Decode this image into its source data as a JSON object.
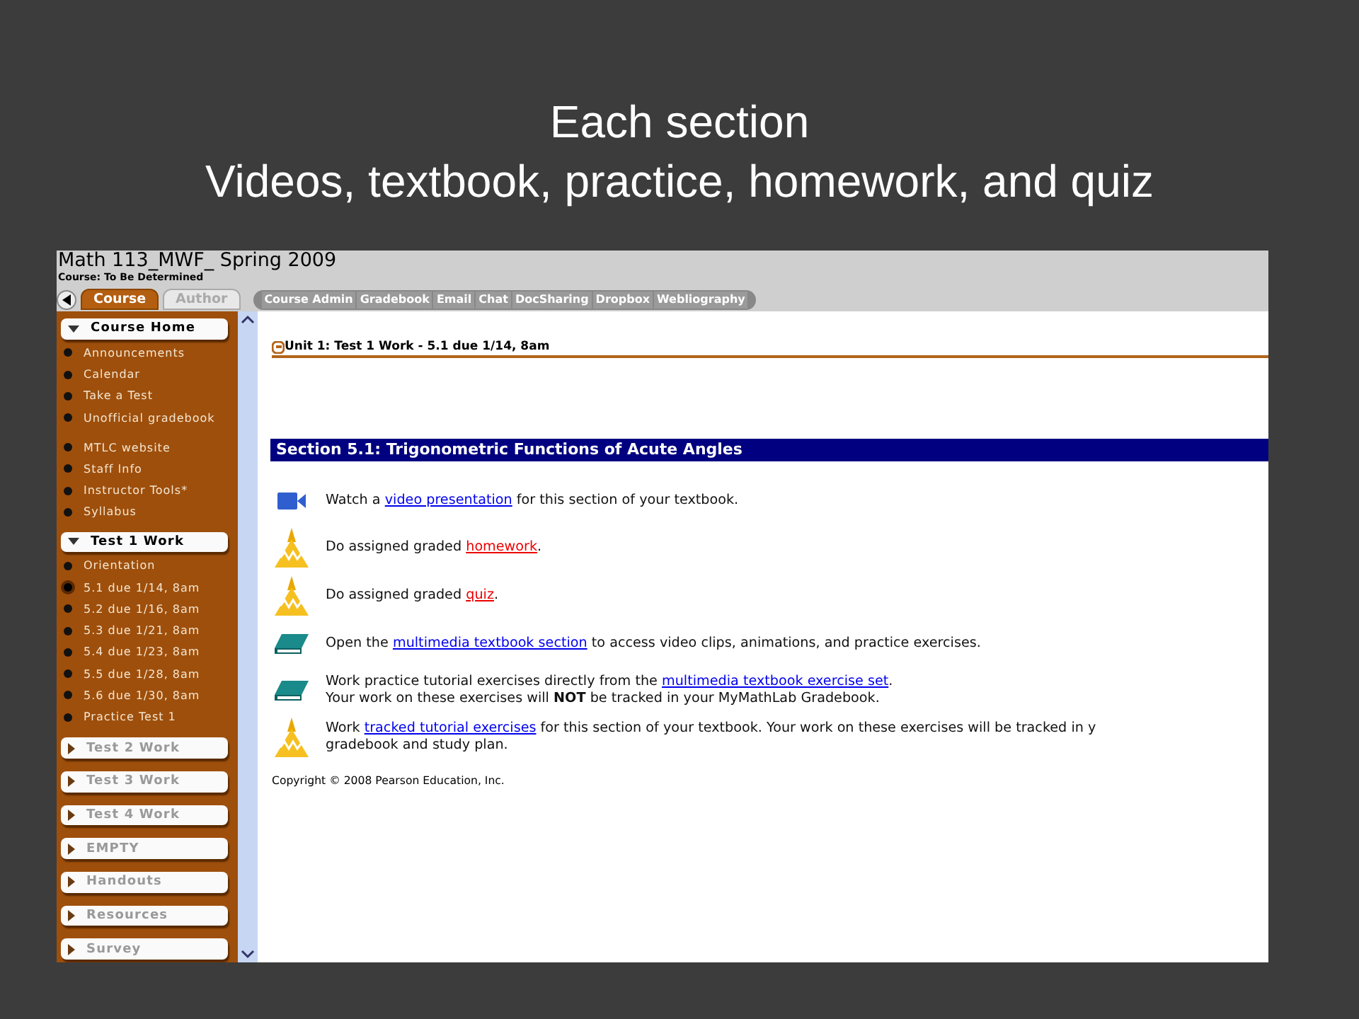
{
  "slide": {
    "title_lines": [
      "Each section",
      "Videos, textbook, practice, homework, and quiz"
    ]
  },
  "course_window": {
    "title": "Math 113_MWF_ Spring 2009",
    "subtitle": "Course: To Be Determined",
    "tabs": [
      {
        "label": "Course",
        "selected": true
      },
      {
        "label": "Author",
        "selected": false
      }
    ],
    "toolbar": [
      "Course Admin",
      "Gradebook",
      "Email",
      "Chat",
      "DocSharing",
      "Dropbox",
      "Webliography"
    ],
    "sidebar": {
      "groups": [
        {
          "label": "Course Home",
          "expanded": true,
          "items": [
            {
              "label": "Announcements",
              "selected": false,
              "separated": false
            },
            {
              "label": "Calendar",
              "selected": false,
              "separated": false
            },
            {
              "label": "Take a Test",
              "selected": false,
              "separated": false
            },
            {
              "label": "Unofficial gradebook",
              "selected": false,
              "separated": false
            },
            {
              "label": "MTLC website",
              "selected": false,
              "separated": true
            },
            {
              "label": "Staff Info",
              "selected": false,
              "separated": false
            },
            {
              "label": "Instructor Tools*",
              "selected": false,
              "separated": false
            },
            {
              "label": "Syllabus",
              "selected": false,
              "separated": false
            }
          ]
        },
        {
          "label": "Test 1 Work",
          "expanded": true,
          "items": [
            {
              "label": "Orientation",
              "selected": false,
              "separated": false
            },
            {
              "label": "5.1 due 1/14, 8am",
              "selected": true,
              "separated": false
            },
            {
              "label": "5.2 due 1/16, 8am",
              "selected": false,
              "separated": false
            },
            {
              "label": "5.3 due 1/21, 8am",
              "selected": false,
              "separated": false
            },
            {
              "label": "5.4 due 1/23, 8am",
              "selected": false,
              "separated": false
            },
            {
              "label": "5.5 due 1/28, 8am",
              "selected": false,
              "separated": false
            },
            {
              "label": "5.6 due 1/30, 8am",
              "selected": false,
              "separated": false
            },
            {
              "label": "Practice Test 1",
              "selected": false,
              "separated": false
            }
          ]
        },
        {
          "label": "Test 2 Work",
          "expanded": false
        },
        {
          "label": "Test 3 Work",
          "expanded": false
        },
        {
          "label": "Test 4 Work",
          "expanded": false
        },
        {
          "label": "EMPTY",
          "expanded": false
        },
        {
          "label": "Handouts",
          "expanded": false
        },
        {
          "label": "Resources",
          "expanded": false
        },
        {
          "label": "Survey",
          "expanded": false
        }
      ]
    },
    "content": {
      "unit_heading": "Unit  1:  Test 1 Work - 5.1 due 1/14, 8am",
      "section_heading": "Section 5.1: Trigonometric Functions of Acute Angles",
      "activities": [
        {
          "kind": "video",
          "before": "Watch a ",
          "link": "video presentation",
          "color": "#0000ee",
          "after": " for this section of your textbook."
        },
        {
          "kind": "graded",
          "before": "Do assigned graded ",
          "link": "homework",
          "color": "#ee0000",
          "after": "."
        },
        {
          "kind": "graded",
          "before": "Do assigned graded ",
          "link": "quiz",
          "color": "#ee0000",
          "after": "."
        },
        {
          "kind": "book",
          "before": "Open the ",
          "link": "multimedia textbook section",
          "color": "#0000ee",
          "after": " to access video clips, animations, and practice exercises."
        },
        {
          "kind": "book",
          "before": "Work practice tutorial exercises directly from the ",
          "link": "multimedia textbook exercise set",
          "color": "#0000ee",
          "after": ".",
          "note": "Your work on these exercises will **NOT** be tracked in your MyMathLab Gradebook."
        },
        {
          "kind": "graded",
          "before": "Work ",
          "link": "tracked tutorial exercises",
          "color": "#0000ee",
          "after": " for this section of your textbook. Your work on these exercises will be tracked in y",
          "note": "gradebook and study plan."
        }
      ],
      "copyright": "Copyright © 2008 Pearson Education, Inc."
    }
  }
}
